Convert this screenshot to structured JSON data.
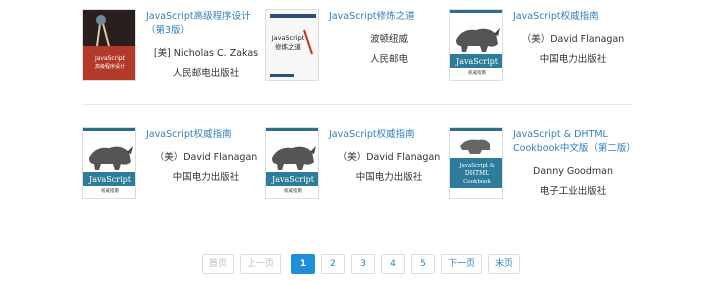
{
  "books": [
    {
      "title": "JavaScript高级程序设计（第3版）",
      "author": "[美] Nicholas C. Zakas",
      "publisher": "人民邮电出版社",
      "cover_icon": "book-cover-js-professional"
    },
    {
      "title": "JavaScript修炼之道",
      "author": "波顿纽威",
      "publisher": "人民邮电",
      "cover_icon": "book-cover-js-ninja"
    },
    {
      "title": "JavaScript权威指南",
      "author": "（美）David Flanagan",
      "publisher": "中国电力出版社",
      "cover_icon": "book-cover-rhino"
    },
    {
      "title": "JavaScript权威指南",
      "author": "（美）David Flanagan",
      "publisher": "中国电力出版社",
      "cover_icon": "book-cover-rhino"
    },
    {
      "title": "JavaScript权威指南",
      "author": "（美）David Flanagan",
      "publisher": "中国电力出版社",
      "cover_icon": "book-cover-rhino"
    },
    {
      "title": "JavaScript & DHTML Cookbook中文版（第二版）",
      "author": "Danny Goodman",
      "publisher": "电子工业出版社",
      "cover_icon": "book-cover-dhtml-cookbook"
    }
  ],
  "covers": {
    "js_ninja_title": "JavaScript 修炼之道",
    "rhino_text": "JavaScript",
    "rhino_sub": "权威指南",
    "dhtml_text": "JavaScript & DHTML Cookbook",
    "pro_js_text": "JavaScript 高级程序设计"
  },
  "pagination": {
    "first": "首页",
    "prev": "上一页",
    "pages": [
      "1",
      "2",
      "3",
      "4",
      "5"
    ],
    "active": "1",
    "next": "下一页",
    "last": "末页"
  },
  "colors": {
    "link": "#2f7fbf",
    "active_page": "#1e8fd8"
  }
}
